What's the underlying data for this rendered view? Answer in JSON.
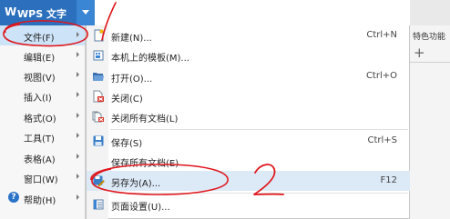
{
  "title_button": {
    "app_name": "WPS 文字"
  },
  "left_menu": {
    "items": [
      {
        "label": "文件(F)"
      },
      {
        "label": "编辑(E)"
      },
      {
        "label": "视图(V)"
      },
      {
        "label": "插入(I)"
      },
      {
        "label": "格式(O)"
      },
      {
        "label": "工具(T)"
      },
      {
        "label": "表格(A)"
      },
      {
        "label": "窗口(W)"
      },
      {
        "label": "帮助(H)",
        "icon": "help-icon"
      }
    ]
  },
  "submenu": {
    "items": [
      {
        "label": "新建(N)...",
        "shortcut": "Ctrl+N",
        "icon": "new-document-icon"
      },
      {
        "label": "本机上的模板(M)...",
        "shortcut": "",
        "icon": "template-icon"
      },
      {
        "label": "打开(O)...",
        "shortcut": "Ctrl+O",
        "icon": "open-folder-icon"
      },
      {
        "label": "关闭(C)",
        "shortcut": "",
        "icon": "close-document-icon"
      },
      {
        "label": "关闭所有文档(L)",
        "shortcut": "",
        "icon": "close-all-documents-icon"
      },
      {
        "label": "保存(S)",
        "shortcut": "Ctrl+S",
        "icon": "save-icon"
      },
      {
        "label": "保存所有文档(E)",
        "shortcut": "",
        "icon": ""
      },
      {
        "label": "另存为(A)...",
        "shortcut": "F12",
        "icon": "save-as-icon"
      },
      {
        "label": "页面设置(U)...",
        "shortcut": "",
        "icon": "page-setup-icon"
      }
    ]
  },
  "background": {
    "feature_tab": "特色功能",
    "new_tab_symbol": "+"
  },
  "annotations": {
    "handwritten_number": "2"
  },
  "colors": {
    "title_bar": "#2b6fbd",
    "menu_highlight": "#dce9f7",
    "annotation": "#e0151b"
  }
}
